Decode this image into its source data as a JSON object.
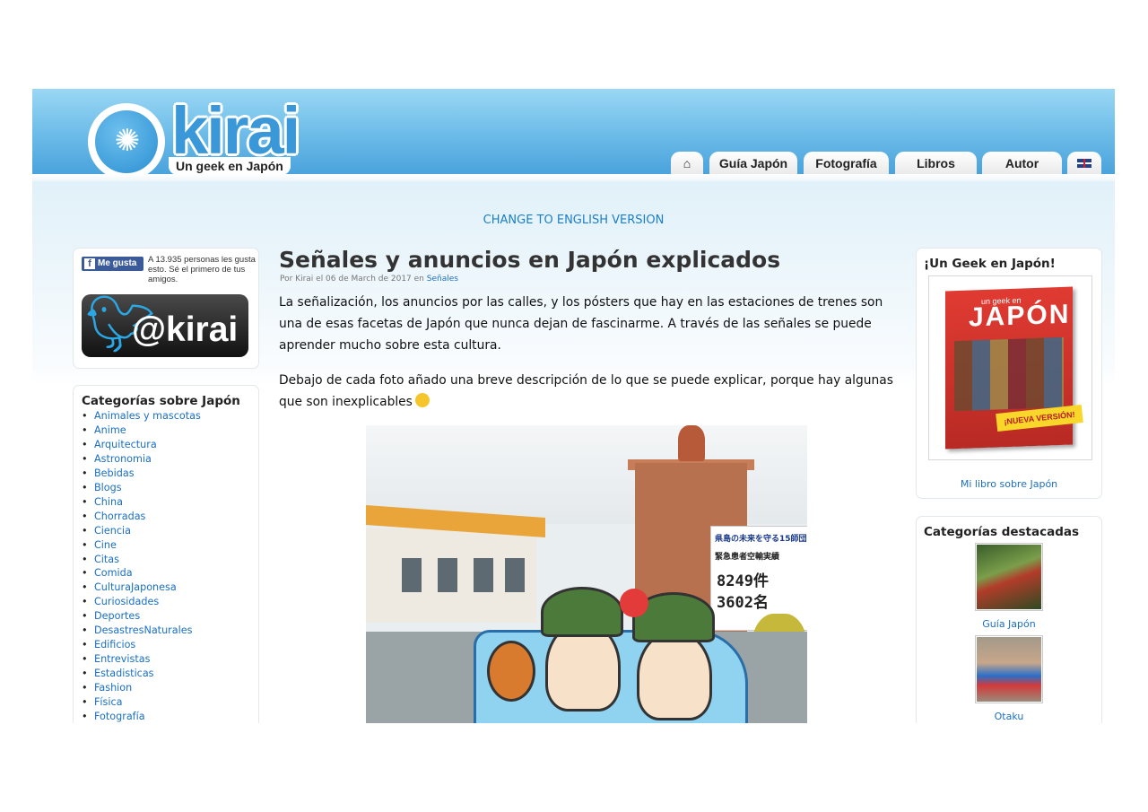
{
  "site": {
    "logo_word": "kirai",
    "logo_tagline": "Un geek en Japón"
  },
  "nav": {
    "home_icon": "home-icon",
    "tabs": [
      "Guía Japón",
      "Fotografía",
      "Libros",
      "Autor"
    ],
    "language_flag_icon": "uk-flag-icon"
  },
  "language_switch": "CHANGE TO ENGLISH VERSION",
  "social": {
    "like_button": "Me gusta",
    "like_text": "A 13.935 personas les gusta esto. Sé el primero de tus amigos.",
    "twitter_handle": "@kirai"
  },
  "categories": {
    "title": "Categorías sobre Japón",
    "items": [
      "Animales y mascotas",
      "Anime",
      "Arquitectura",
      "Astronomia",
      "Bebidas",
      "Blogs",
      "China",
      "Chorradas",
      "Ciencia",
      "Cine",
      "Citas",
      "Comida",
      "CulturaJaponesa",
      "Curiosidades",
      "Deportes",
      "DesastresNaturales",
      "Edificios",
      "Entrevistas",
      "Estadisticas",
      "Fashion",
      "Física",
      "Fotografía"
    ]
  },
  "article": {
    "title": "Señales y anuncios en Japón explicados",
    "meta_prefix": "Por Kirai el 06 de March de 2017 en ",
    "meta_category": "Señales",
    "paragraph1": "La señalización, los anuncios por las calles, y los pósters que hay en las estaciones de trenes son una de esas facetas de Japón que nunca dejan de fascinarme. A través de las señales se puede aprender mucho sobre esta cultura.",
    "paragraph2": "Debajo de cada foto añado una breve descripción de lo que se puede explicar, porque hay algunas que son inexplicables",
    "photo_sign": {
      "header": "県島の未来を守る15師団",
      "line1": "緊急患者空輸実績",
      "number1": "8249件",
      "number2": "3602名"
    }
  },
  "book": {
    "title": "¡Un Geek en Japón!",
    "cover_subtitle": "un geek en",
    "cover_title": "JAPÓN",
    "cover_ribbon": "¡NUEVA VERSIÓN!",
    "link": "Mi libro sobre Japón"
  },
  "featured": {
    "title": "Categorías destacadas",
    "items": [
      {
        "label": "Guía Japón"
      },
      {
        "label": "Otaku"
      }
    ]
  },
  "colors": {
    "link": "#1a6fc4",
    "header_blue": "#4aa3dc",
    "logo_blue": "#3a97d8"
  }
}
